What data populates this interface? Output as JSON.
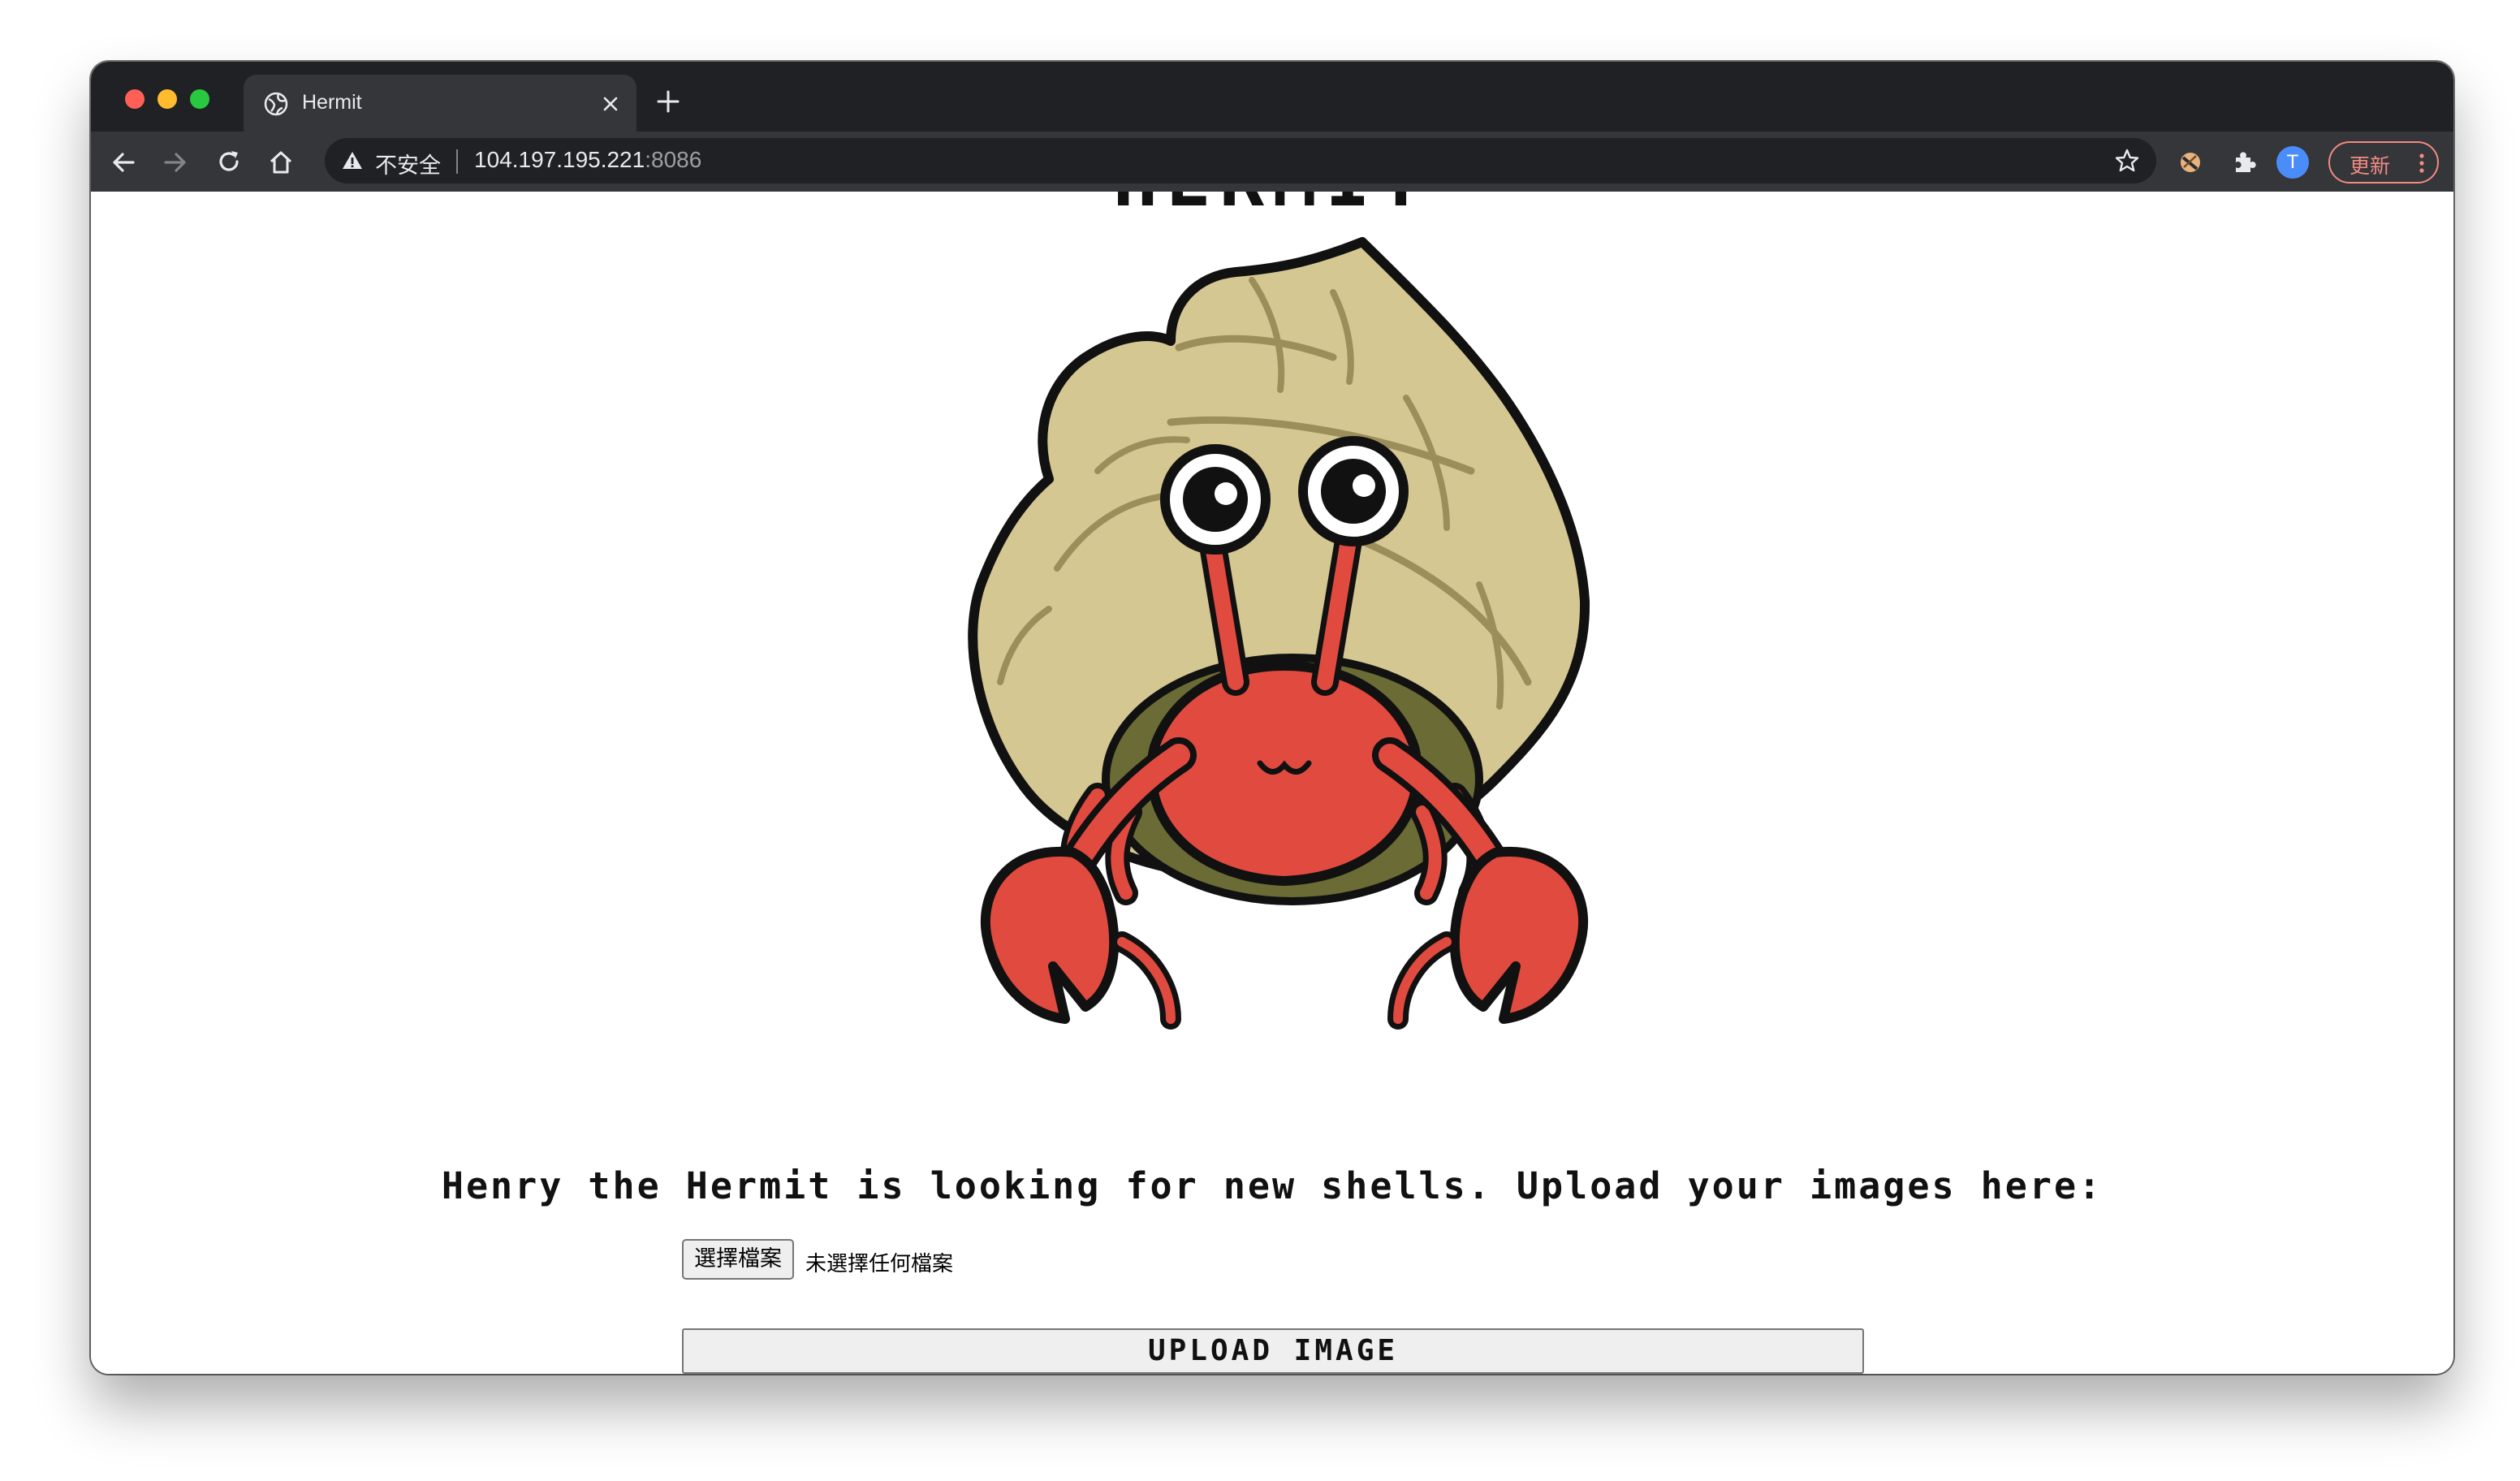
{
  "browser": {
    "tab_title": "Hermit",
    "address": {
      "security_label": "不安全",
      "host": "104.197.195.221",
      "port": ":8086"
    },
    "profile_initial": "T",
    "update_label": "更新",
    "icons": [
      "back-icon",
      "forward-icon",
      "reload-icon",
      "home-icon",
      "warning-icon",
      "star-icon",
      "extension-icon",
      "puzzle-icon",
      "globe-icon",
      "close-icon",
      "plus-icon",
      "more-icon"
    ]
  },
  "page": {
    "heading": "HERMIT",
    "tagline": "Henry the Hermit is looking for new shells. Upload your images here:",
    "file_input": {
      "button_label": "選擇檔案",
      "status": "未選擇任何檔案"
    },
    "upload_button": "UPLOAD IMAGE"
  },
  "colors": {
    "shell": "#d4c791",
    "crab": "#e04a3f",
    "outline": "#111111",
    "update_accent": "#f28b82",
    "avatar": "#4b8df8"
  }
}
